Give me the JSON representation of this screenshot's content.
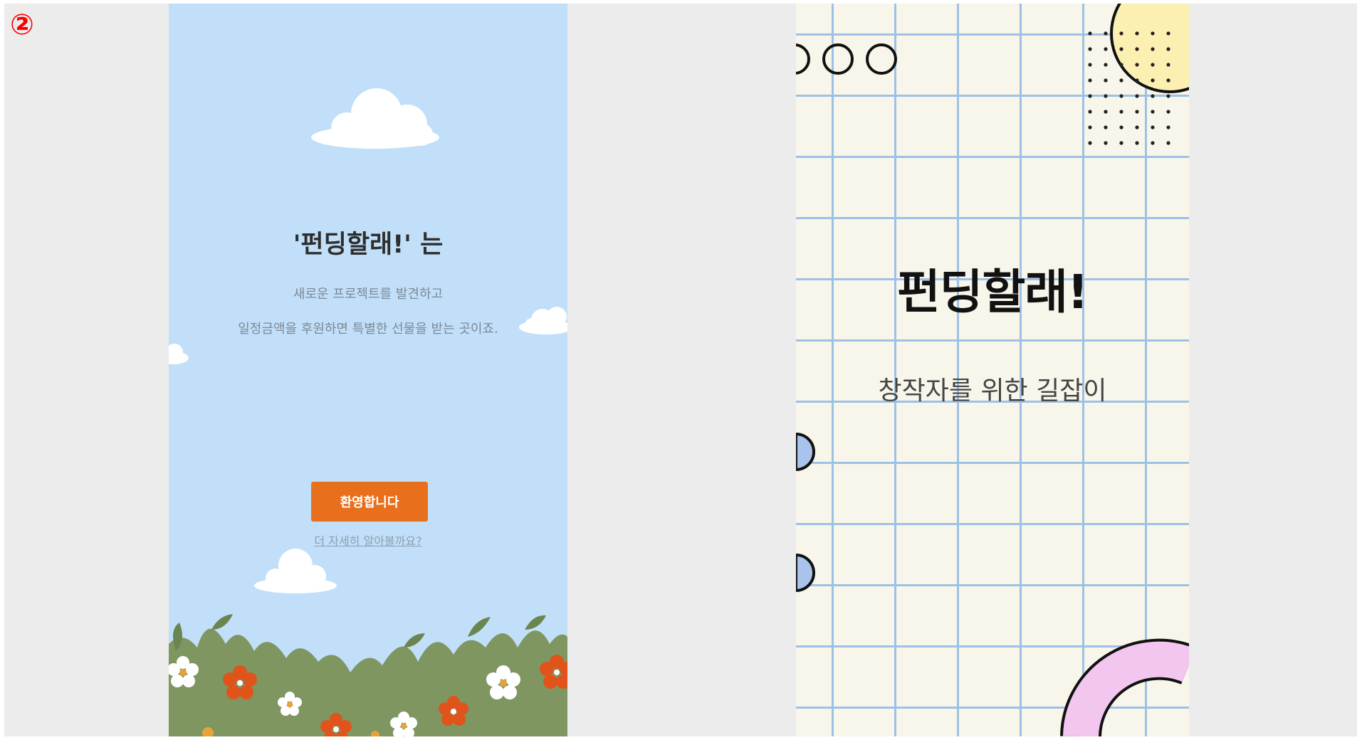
{
  "step_badge": "②",
  "left_screen": {
    "title": "'펀딩할래!' 는",
    "description_line1": "새로운 프로젝트를 발견하고",
    "description_line2": "일정금액을 후원하면 특별한 선물을 받는 곳이죠.",
    "welcome_button": "환영합니다",
    "learn_more_link": "더 자세히 알아볼까요?"
  },
  "right_screen": {
    "title": "펀딩할래!",
    "subtitle": "창작자를 위한 길잡이"
  },
  "colors": {
    "sky": "#c1dff8",
    "button": "#e8701d",
    "grid_line": "#9dc1e6",
    "paper": "#f8f6ea",
    "badge": "#ff0000"
  }
}
